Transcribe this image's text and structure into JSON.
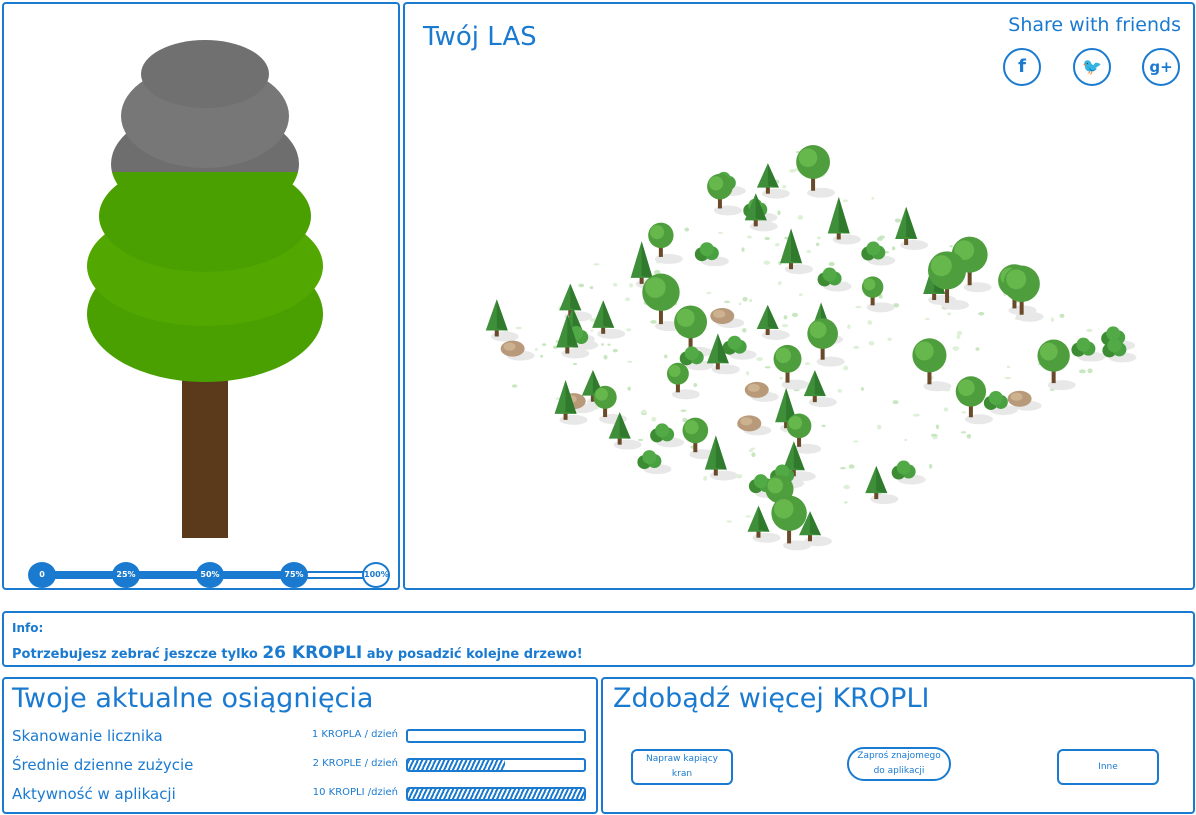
{
  "tree_panel": {
    "progress": {
      "fraction": 0.75,
      "markers": [
        "0",
        "25%",
        "50%",
        "75%",
        "100%"
      ]
    }
  },
  "forest": {
    "title": "Twój LAS",
    "share_label": "Share with friends",
    "share_buttons": [
      {
        "network": "facebook-icon",
        "glyph": "f"
      },
      {
        "network": "twitter-icon",
        "glyph": "🐦"
      },
      {
        "network": "google-plus-icon",
        "glyph": "g+"
      }
    ]
  },
  "info": {
    "label": "Info:",
    "text_before": "Potrzebujesz zebrać jeszcze tylko ",
    "amount": "26 KROPLI",
    "text_after": " aby posadzić kolejne drzewo!"
  },
  "achievements": {
    "title": "Twoje aktualne osiągnięcia",
    "rows": [
      {
        "name": "Skanowanie licznika",
        "rate": "1 KROPLA / dzień",
        "progress": 0.0
      },
      {
        "name": "Średnie dzienne zużycie",
        "rate": "2 KROPLE / dzień",
        "progress": 0.55
      },
      {
        "name": "Aktywność w aplikacji",
        "rate": "10 KROPLI  /dzień",
        "progress": 1.0
      }
    ]
  },
  "earn_more": {
    "title": "Zdobądź więcej KROPLI",
    "buttons": [
      "Napraw kapiący kran",
      "Zaproś znajomego do aplikacji",
      "Inne"
    ]
  },
  "colors": {
    "accent": "#1a7ad0",
    "tree_green": "#4aa000",
    "tree_gray": "#6e6e6e",
    "trunk": "#5a3a1a"
  }
}
